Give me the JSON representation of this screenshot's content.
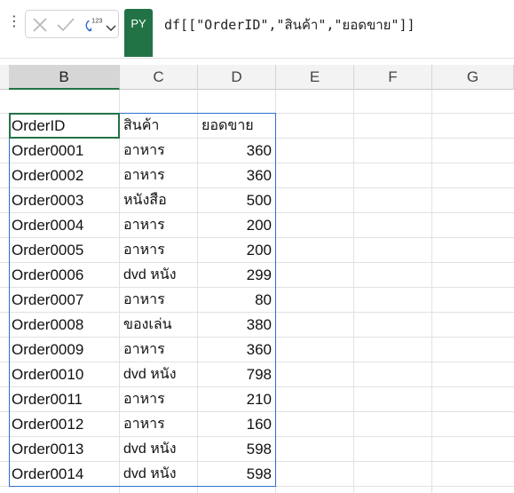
{
  "formula_bar": {
    "more_icon": "vertical-dots-icon",
    "cancel_icon": "x-icon",
    "enter_icon": "check-icon",
    "python_badge_label": "123",
    "py_label": "PY",
    "formula": "df[[\"OrderID\",\"สินค้า\",\"ยอดขาย\"]]"
  },
  "columns": [
    "B",
    "C",
    "D",
    "E",
    "F",
    "G"
  ],
  "selected_column": "B",
  "table": {
    "headers": [
      "OrderID",
      "สินค้า",
      "ยอดขาย"
    ],
    "rows": [
      [
        "Order0001",
        "อาหาร",
        "360"
      ],
      [
        "Order0002",
        "อาหาร",
        "360"
      ],
      [
        "Order0003",
        "หนังสือ",
        "500"
      ],
      [
        "Order0004",
        "อาหาร",
        "200"
      ],
      [
        "Order0005",
        "อาหาร",
        "200"
      ],
      [
        "Order0006",
        "dvd หนัง",
        "299"
      ],
      [
        "Order0007",
        "อาหาร",
        "80"
      ],
      [
        "Order0008",
        "ของเล่น",
        "380"
      ],
      [
        "Order0009",
        "อาหาร",
        "360"
      ],
      [
        "Order0010",
        "dvd หนัง",
        "798"
      ],
      [
        "Order0011",
        "อาหาร",
        "210"
      ],
      [
        "Order0012",
        "อาหาร",
        "160"
      ],
      [
        "Order0013",
        "dvd หนัง",
        "598"
      ],
      [
        "Order0014",
        "dvd หนัง",
        "598"
      ]
    ]
  },
  "colors": {
    "accent_green": "#217346",
    "range_blue": "#2f6fcf"
  }
}
